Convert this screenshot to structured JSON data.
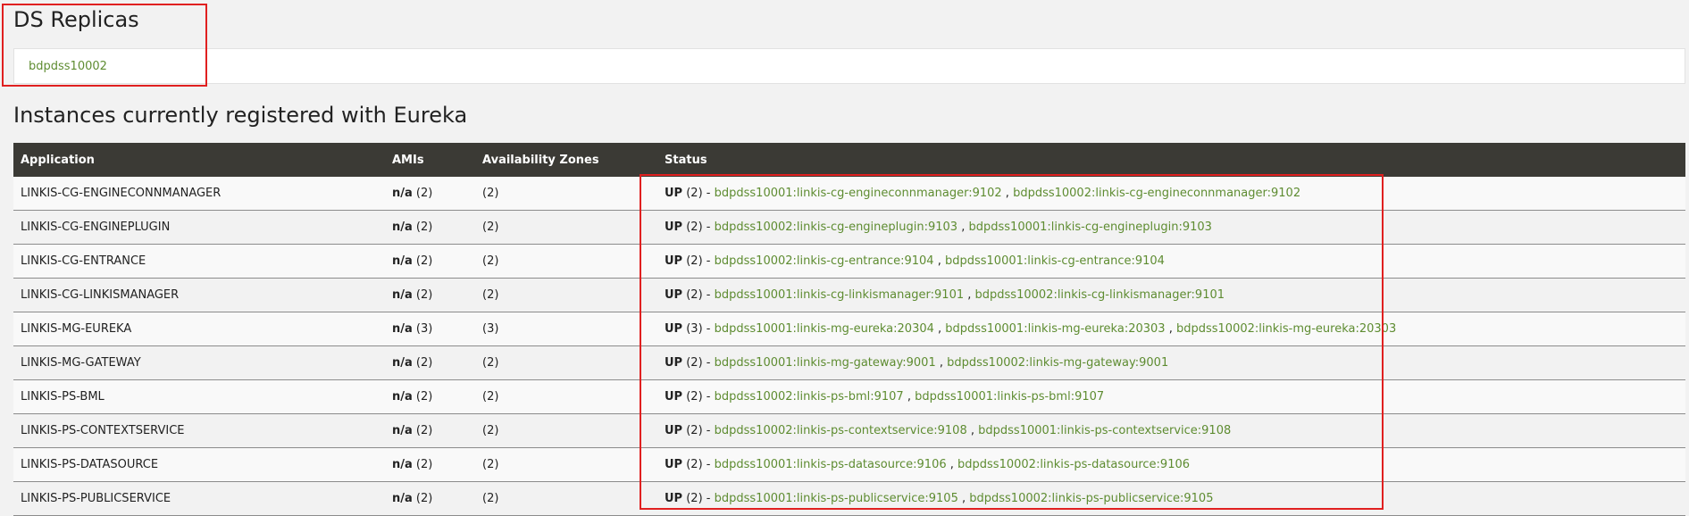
{
  "replicas": {
    "title": "DS Replicas",
    "items": [
      "bdpdss10002"
    ]
  },
  "instances": {
    "title": "Instances currently registered with Eureka",
    "columns": [
      "Application",
      "AMIs",
      "Availability Zones",
      "Status"
    ],
    "rows": [
      {
        "app": "LINKIS-CG-ENGINECONNMANAGER",
        "ami": "n/a",
        "ami_count": "(2)",
        "az": "(2)",
        "status": "UP",
        "status_count": "(2)",
        "instances": [
          "bdpdss10001:linkis-cg-engineconnmanager:9102",
          "bdpdss10002:linkis-cg-engineconnmanager:9102"
        ]
      },
      {
        "app": "LINKIS-CG-ENGINEPLUGIN",
        "ami": "n/a",
        "ami_count": "(2)",
        "az": "(2)",
        "status": "UP",
        "status_count": "(2)",
        "instances": [
          "bdpdss10002:linkis-cg-engineplugin:9103",
          "bdpdss10001:linkis-cg-engineplugin:9103"
        ]
      },
      {
        "app": "LINKIS-CG-ENTRANCE",
        "ami": "n/a",
        "ami_count": "(2)",
        "az": "(2)",
        "status": "UP",
        "status_count": "(2)",
        "instances": [
          "bdpdss10002:linkis-cg-entrance:9104",
          "bdpdss10001:linkis-cg-entrance:9104"
        ]
      },
      {
        "app": "LINKIS-CG-LINKISMANAGER",
        "ami": "n/a",
        "ami_count": "(2)",
        "az": "(2)",
        "status": "UP",
        "status_count": "(2)",
        "instances": [
          "bdpdss10001:linkis-cg-linkismanager:9101",
          "bdpdss10002:linkis-cg-linkismanager:9101"
        ]
      },
      {
        "app": "LINKIS-MG-EUREKA",
        "ami": "n/a",
        "ami_count": "(3)",
        "az": "(3)",
        "status": "UP",
        "status_count": "(3)",
        "instances": [
          "bdpdss10001:linkis-mg-eureka:20304",
          "bdpdss10001:linkis-mg-eureka:20303",
          "bdpdss10002:linkis-mg-eureka:20303"
        ]
      },
      {
        "app": "LINKIS-MG-GATEWAY",
        "ami": "n/a",
        "ami_count": "(2)",
        "az": "(2)",
        "status": "UP",
        "status_count": "(2)",
        "instances": [
          "bdpdss10001:linkis-mg-gateway:9001",
          "bdpdss10002:linkis-mg-gateway:9001"
        ]
      },
      {
        "app": "LINKIS-PS-BML",
        "ami": "n/a",
        "ami_count": "(2)",
        "az": "(2)",
        "status": "UP",
        "status_count": "(2)",
        "instances": [
          "bdpdss10002:linkis-ps-bml:9107",
          "bdpdss10001:linkis-ps-bml:9107"
        ]
      },
      {
        "app": "LINKIS-PS-CONTEXTSERVICE",
        "ami": "n/a",
        "ami_count": "(2)",
        "az": "(2)",
        "status": "UP",
        "status_count": "(2)",
        "instances": [
          "bdpdss10002:linkis-ps-contextservice:9108",
          "bdpdss10001:linkis-ps-contextservice:9108"
        ]
      },
      {
        "app": "LINKIS-PS-DATASOURCE",
        "ami": "n/a",
        "ami_count": "(2)",
        "az": "(2)",
        "status": "UP",
        "status_count": "(2)",
        "instances": [
          "bdpdss10001:linkis-ps-datasource:9106",
          "bdpdss10002:linkis-ps-datasource:9106"
        ]
      },
      {
        "app": "LINKIS-PS-PUBLICSERVICE",
        "ami": "n/a",
        "ami_count": "(2)",
        "az": "(2)",
        "status": "UP",
        "status_count": "(2)",
        "instances": [
          "bdpdss10001:linkis-ps-publicservice:9105",
          "bdpdss10002:linkis-ps-publicservice:9105"
        ]
      }
    ]
  },
  "colors": {
    "link": "#5e8c31",
    "header_bg": "#3b3a35",
    "highlight": "#e02020"
  }
}
